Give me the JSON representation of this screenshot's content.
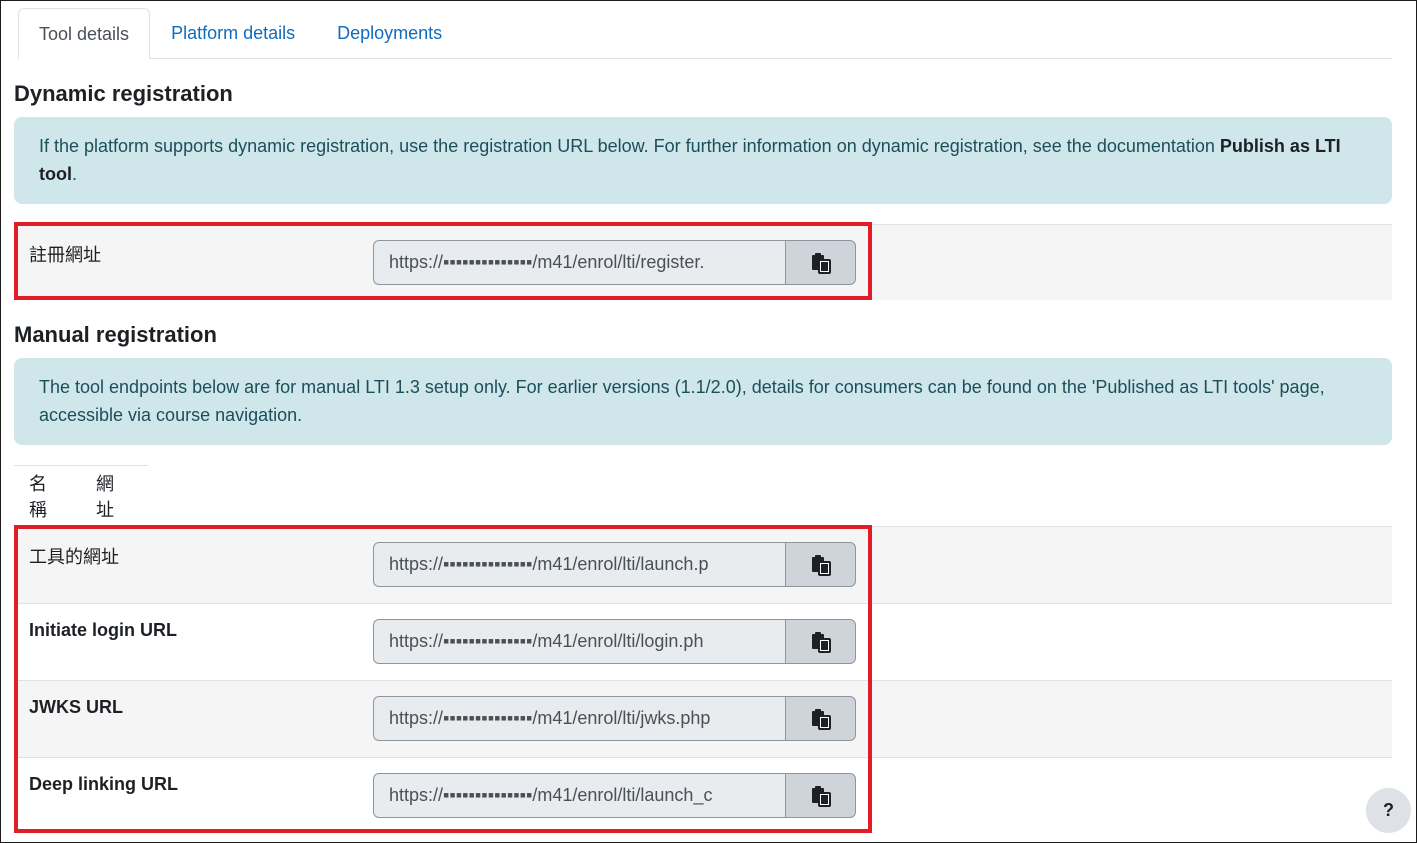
{
  "tabs": [
    {
      "label": "Tool details",
      "active": true
    },
    {
      "label": "Platform details",
      "active": false
    },
    {
      "label": "Deployments",
      "active": false
    }
  ],
  "dynamic": {
    "heading": "Dynamic registration",
    "info_text": "If the platform supports dynamic registration, use the registration URL below. For further information on dynamic registration, see the documentation ",
    "info_link": "Publish as LTI tool",
    "info_end": ".",
    "row": {
      "label": "註冊網址",
      "value": "https://▪▪▪▪▪▪▪▪▪▪▪▪▪▪/m41/enrol/lti/register."
    }
  },
  "manual": {
    "heading": "Manual registration",
    "info_text": "The tool endpoints below are for manual LTI 1.3 setup only. For earlier versions (1.1/2.0), details for consumers can be found on the 'Published as LTI tools' page, accessible via course navigation.",
    "table_headers": [
      "名稱",
      "網址"
    ],
    "rows": [
      {
        "label": "工具的網址",
        "value": "https://▪▪▪▪▪▪▪▪▪▪▪▪▪▪/m41/enrol/lti/launch.p"
      },
      {
        "label": "Initiate login URL",
        "value": "https://▪▪▪▪▪▪▪▪▪▪▪▪▪▪/m41/enrol/lti/login.ph"
      },
      {
        "label": "JWKS URL",
        "value": "https://▪▪▪▪▪▪▪▪▪▪▪▪▪▪/m41/enrol/lti/jwks.php"
      },
      {
        "label": "Deep linking URL",
        "value": "https://▪▪▪▪▪▪▪▪▪▪▪▪▪▪/m41/enrol/lti/launch_c"
      }
    ]
  },
  "help_label": "?",
  "colors": {
    "accent": "#0f6cbf",
    "alert_bg": "#cfe6ea",
    "highlight": "#e11d2a"
  }
}
